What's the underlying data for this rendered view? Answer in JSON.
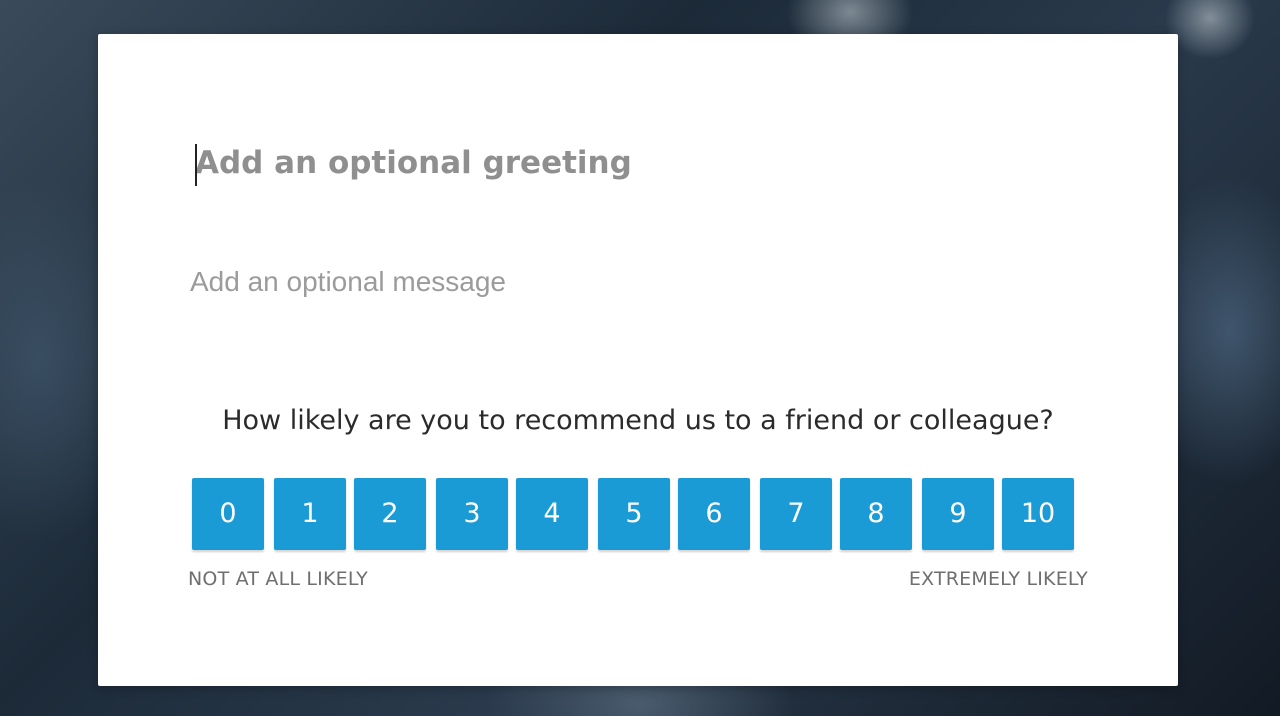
{
  "form": {
    "greeting_placeholder": "Add an optional greeting",
    "message_placeholder": "Add an optional message",
    "question": "How likely are you to recommend us to a friend or colleague?",
    "scores": [
      "0",
      "1",
      "2",
      "3",
      "4",
      "5",
      "6",
      "7",
      "8",
      "9",
      "10"
    ],
    "low_label": "NOT AT ALL LIKELY",
    "high_label": "EXTREMELY LIKELY"
  },
  "colors": {
    "button": "#1a9bd5",
    "button_text": "#ffffff",
    "card": "#ffffff"
  }
}
